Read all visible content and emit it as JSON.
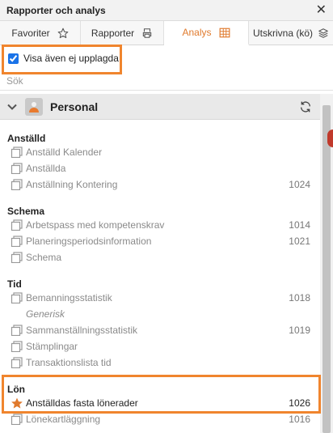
{
  "window": {
    "title": "Rapporter och analys"
  },
  "tabs": [
    {
      "label": "Favoriter",
      "icon": "star-icon"
    },
    {
      "label": "Rapporter",
      "icon": "printer-icon"
    },
    {
      "label": "Analys",
      "icon": "grid-icon",
      "active": true
    },
    {
      "label": "Utskrivna (kö)",
      "icon": "stack-icon"
    }
  ],
  "filter": {
    "show_unpublished_label": "Visa även ej upplagda",
    "checked": true
  },
  "search": {
    "placeholder": "Sök"
  },
  "group": {
    "title": "Personal",
    "icon": "person-icon"
  },
  "sections": [
    {
      "title": "Anställd",
      "items": [
        {
          "label": "Anställd Kalender",
          "number": ""
        },
        {
          "label": "Anställda",
          "number": ""
        },
        {
          "label": "Anställning Kontering",
          "number": "1024"
        }
      ]
    },
    {
      "title": "Schema",
      "items": [
        {
          "label": "Arbetspass med kompetenskrav",
          "number": "1014"
        },
        {
          "label": "Planeringsperiodsinformation",
          "number": "1021"
        },
        {
          "label": "Schema",
          "number": ""
        }
      ]
    },
    {
      "title": "Tid",
      "items": [
        {
          "label": "Bemanningsstatistik",
          "number": "1018"
        },
        {
          "label": "Sammanställningsstatistik",
          "number": "1019"
        },
        {
          "label": "Stämplingar",
          "number": ""
        },
        {
          "label": "Transaktionslista tid",
          "number": ""
        }
      ],
      "sublabel": "Generisk"
    },
    {
      "title": "Lön",
      "items": [
        {
          "label": "Anställdas fasta lönerader",
          "number": "1026",
          "favorite": true
        },
        {
          "label": "Lönekartläggning",
          "number": "1016"
        }
      ]
    }
  ],
  "colors": {
    "accent": "#e07a2d",
    "highlight": "#f0852e",
    "checkbox": "#1a73e8"
  }
}
